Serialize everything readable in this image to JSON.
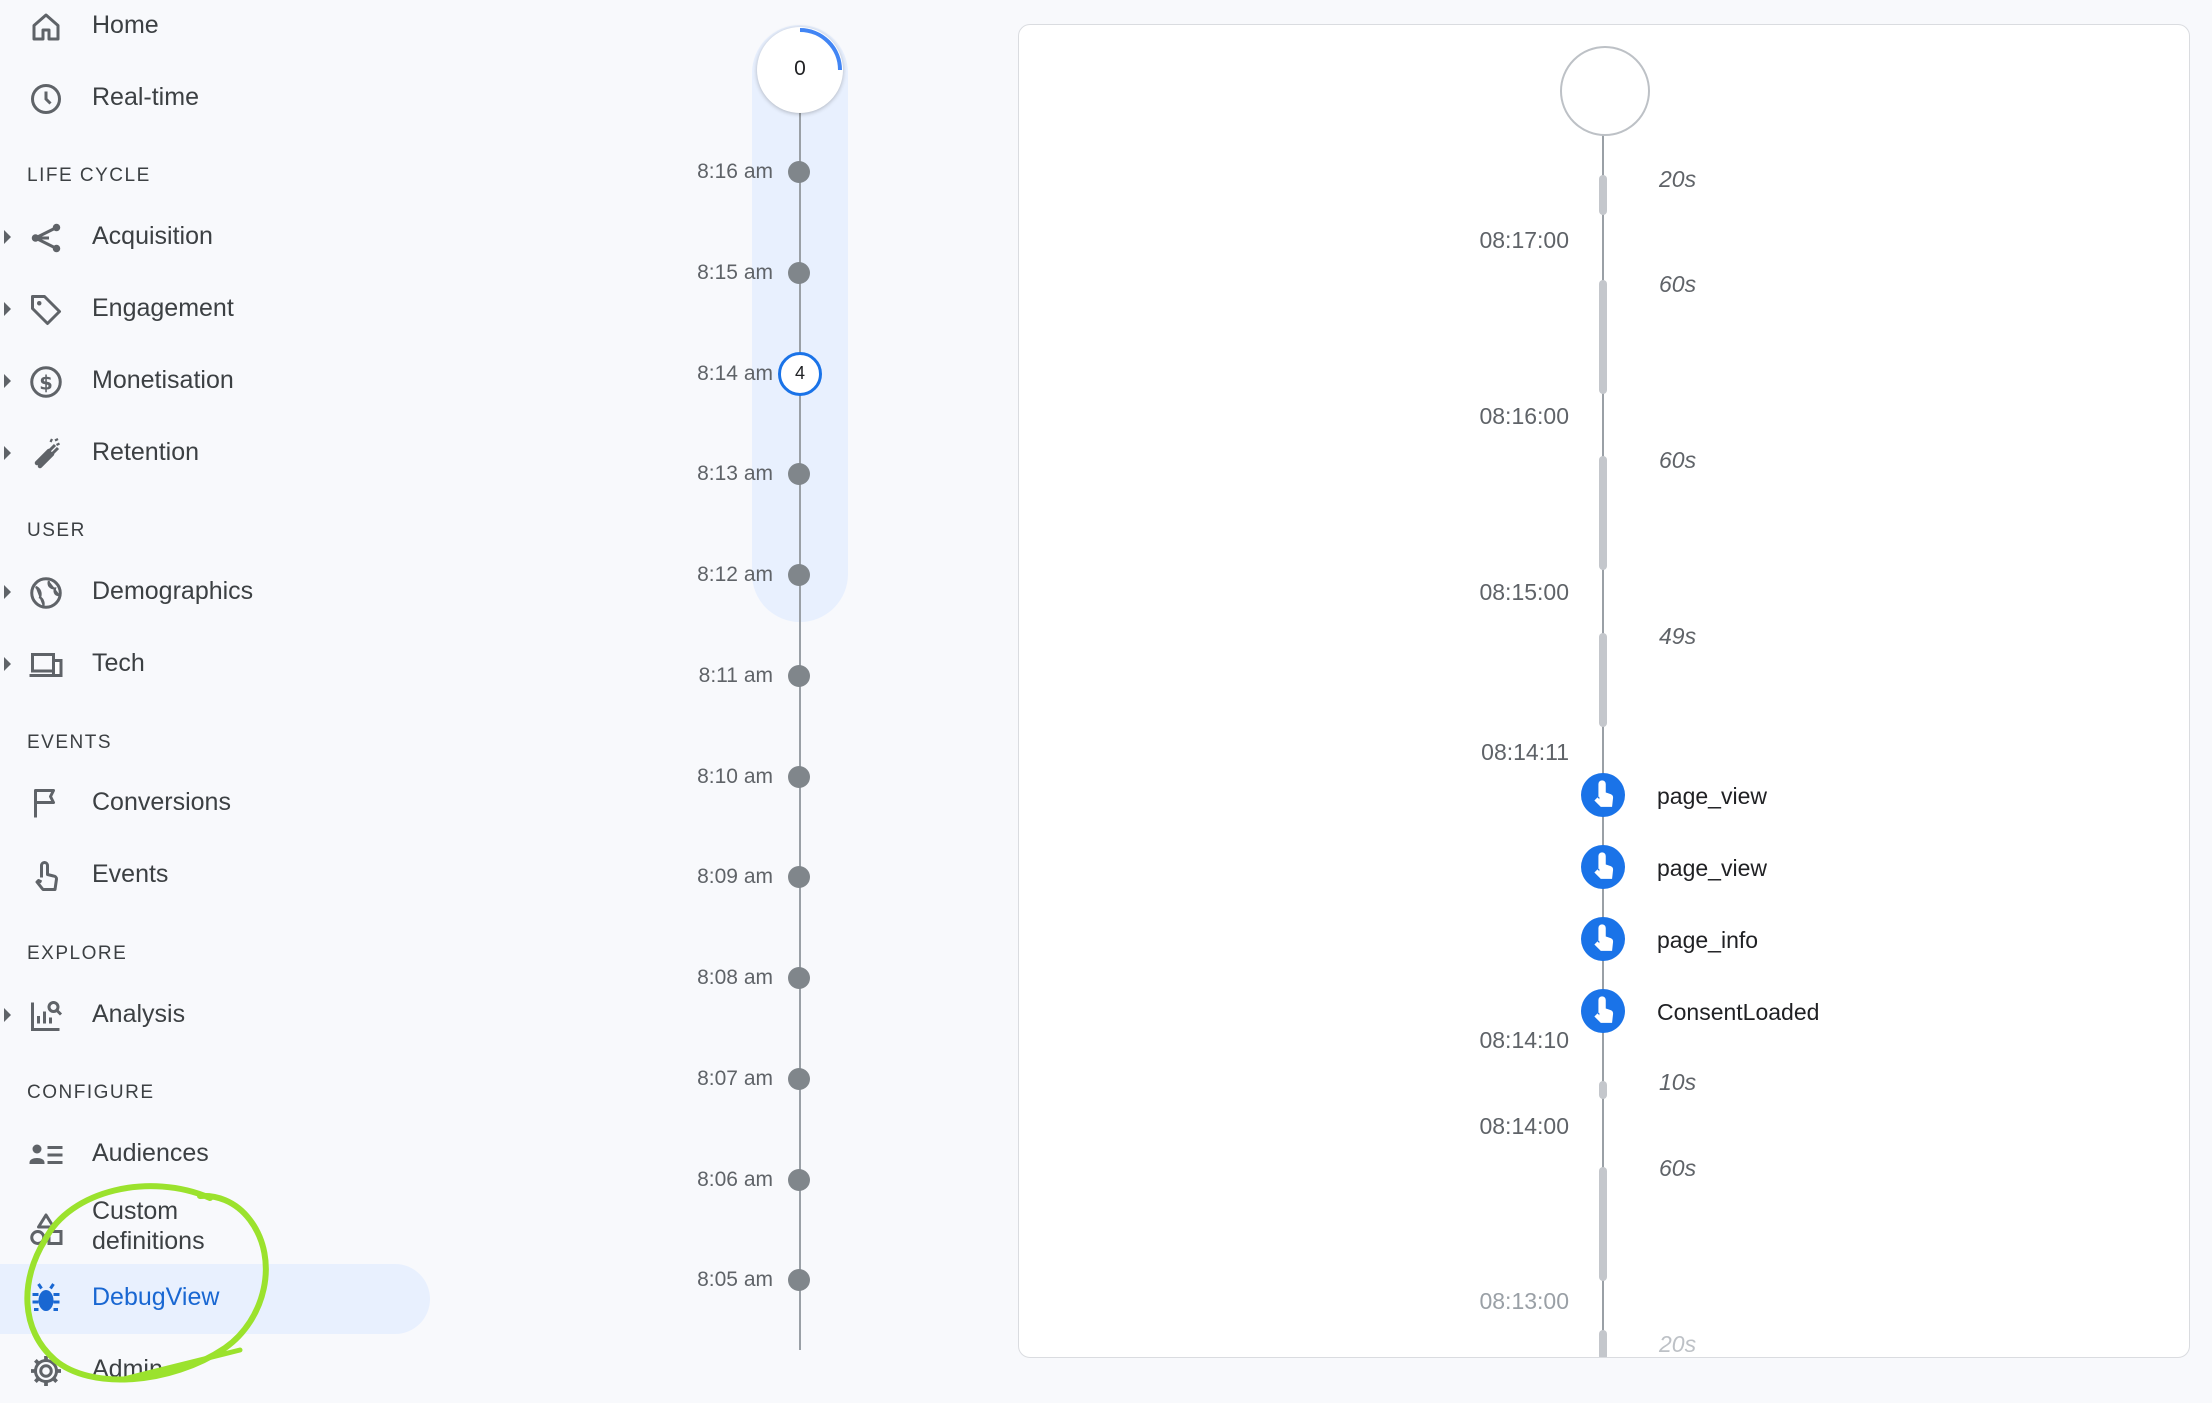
{
  "sidebar": {
    "items": [
      {
        "label": "Home",
        "icon": "home-icon"
      },
      {
        "label": "Real-time",
        "icon": "clock-icon"
      },
      {
        "label": "Acquisition",
        "icon": "acquisition-icon"
      },
      {
        "label": "Engagement",
        "icon": "tag-icon"
      },
      {
        "label": "Monetisation",
        "icon": "dollar-icon"
      },
      {
        "label": "Retention",
        "icon": "magnet-icon"
      },
      {
        "label": "Demographics",
        "icon": "globe-icon"
      },
      {
        "label": "Tech",
        "icon": "devices-icon"
      },
      {
        "label": "Conversions",
        "icon": "flag-icon"
      },
      {
        "label": "Events",
        "icon": "touch-icon"
      },
      {
        "label": "Analysis",
        "icon": "analysis-icon"
      },
      {
        "label": "Audiences",
        "icon": "audiences-icon"
      },
      {
        "label": "Custom",
        "label2": "definitions",
        "icon": "shapes-icon"
      },
      {
        "label": "DebugView",
        "icon": "bug-icon"
      },
      {
        "label": "Admin",
        "icon": "gear-icon"
      }
    ],
    "sections": [
      "LIFE CYCLE",
      "USER",
      "EVENTS",
      "EXPLORE",
      "CONFIGURE"
    ],
    "active_color": "#1967d2"
  },
  "minutes": {
    "top_count": "0",
    "labels": [
      "8:16 am",
      "8:15 am",
      "8:14 am",
      "8:13 am",
      "8:12 am",
      "8:11 am",
      "8:10 am",
      "8:09 am",
      "8:08 am",
      "8:07 am",
      "8:06 am",
      "8:05 am"
    ],
    "selected_count": "4"
  },
  "seconds": {
    "timestamps": [
      "08:17:00",
      "08:16:00",
      "08:15:00",
      "08:14:11",
      "08:14:10",
      "08:14:00",
      "08:13:00"
    ],
    "durations": [
      "20s",
      "60s",
      "60s",
      "49s",
      "10s",
      "60s",
      "20s"
    ],
    "events": [
      "page_view",
      "page_view",
      "page_info",
      "ConsentLoaded"
    ]
  },
  "colors": {
    "accent": "#1a73e8",
    "highlight": "#e8f0fe",
    "annotation": "#9be22d"
  }
}
